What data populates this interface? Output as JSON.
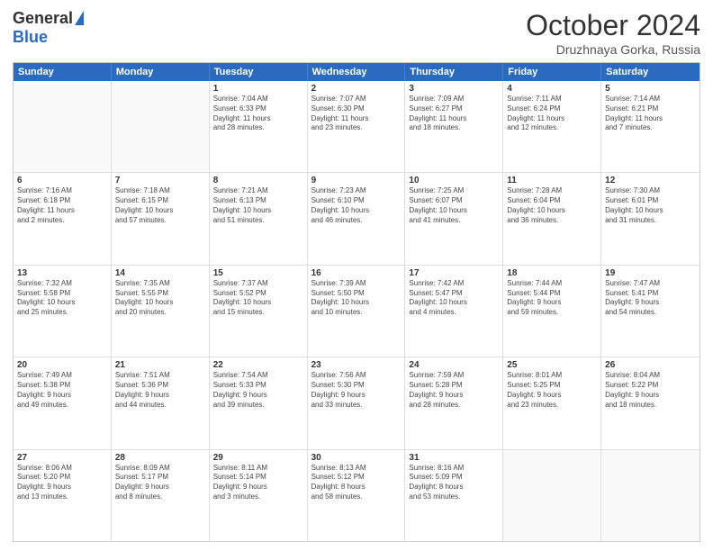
{
  "logo": {
    "general": "General",
    "blue": "Blue"
  },
  "header": {
    "title": "October 2024",
    "subtitle": "Druzhnaya Gorka, Russia"
  },
  "weekdays": [
    "Sunday",
    "Monday",
    "Tuesday",
    "Wednesday",
    "Thursday",
    "Friday",
    "Saturday"
  ],
  "rows": [
    [
      {
        "day": "",
        "lines": []
      },
      {
        "day": "",
        "lines": []
      },
      {
        "day": "1",
        "lines": [
          "Sunrise: 7:04 AM",
          "Sunset: 6:33 PM",
          "Daylight: 11 hours",
          "and 28 minutes."
        ]
      },
      {
        "day": "2",
        "lines": [
          "Sunrise: 7:07 AM",
          "Sunset: 6:30 PM",
          "Daylight: 11 hours",
          "and 23 minutes."
        ]
      },
      {
        "day": "3",
        "lines": [
          "Sunrise: 7:09 AM",
          "Sunset: 6:27 PM",
          "Daylight: 11 hours",
          "and 18 minutes."
        ]
      },
      {
        "day": "4",
        "lines": [
          "Sunrise: 7:11 AM",
          "Sunset: 6:24 PM",
          "Daylight: 11 hours",
          "and 12 minutes."
        ]
      },
      {
        "day": "5",
        "lines": [
          "Sunrise: 7:14 AM",
          "Sunset: 6:21 PM",
          "Daylight: 11 hours",
          "and 7 minutes."
        ]
      }
    ],
    [
      {
        "day": "6",
        "lines": [
          "Sunrise: 7:16 AM",
          "Sunset: 6:18 PM",
          "Daylight: 11 hours",
          "and 2 minutes."
        ]
      },
      {
        "day": "7",
        "lines": [
          "Sunrise: 7:18 AM",
          "Sunset: 6:15 PM",
          "Daylight: 10 hours",
          "and 57 minutes."
        ]
      },
      {
        "day": "8",
        "lines": [
          "Sunrise: 7:21 AM",
          "Sunset: 6:13 PM",
          "Daylight: 10 hours",
          "and 51 minutes."
        ]
      },
      {
        "day": "9",
        "lines": [
          "Sunrise: 7:23 AM",
          "Sunset: 6:10 PM",
          "Daylight: 10 hours",
          "and 46 minutes."
        ]
      },
      {
        "day": "10",
        "lines": [
          "Sunrise: 7:25 AM",
          "Sunset: 6:07 PM",
          "Daylight: 10 hours",
          "and 41 minutes."
        ]
      },
      {
        "day": "11",
        "lines": [
          "Sunrise: 7:28 AM",
          "Sunset: 6:04 PM",
          "Daylight: 10 hours",
          "and 36 minutes."
        ]
      },
      {
        "day": "12",
        "lines": [
          "Sunrise: 7:30 AM",
          "Sunset: 6:01 PM",
          "Daylight: 10 hours",
          "and 31 minutes."
        ]
      }
    ],
    [
      {
        "day": "13",
        "lines": [
          "Sunrise: 7:32 AM",
          "Sunset: 5:58 PM",
          "Daylight: 10 hours",
          "and 25 minutes."
        ]
      },
      {
        "day": "14",
        "lines": [
          "Sunrise: 7:35 AM",
          "Sunset: 5:55 PM",
          "Daylight: 10 hours",
          "and 20 minutes."
        ]
      },
      {
        "day": "15",
        "lines": [
          "Sunrise: 7:37 AM",
          "Sunset: 5:52 PM",
          "Daylight: 10 hours",
          "and 15 minutes."
        ]
      },
      {
        "day": "16",
        "lines": [
          "Sunrise: 7:39 AM",
          "Sunset: 5:50 PM",
          "Daylight: 10 hours",
          "and 10 minutes."
        ]
      },
      {
        "day": "17",
        "lines": [
          "Sunrise: 7:42 AM",
          "Sunset: 5:47 PM",
          "Daylight: 10 hours",
          "and 4 minutes."
        ]
      },
      {
        "day": "18",
        "lines": [
          "Sunrise: 7:44 AM",
          "Sunset: 5:44 PM",
          "Daylight: 9 hours",
          "and 59 minutes."
        ]
      },
      {
        "day": "19",
        "lines": [
          "Sunrise: 7:47 AM",
          "Sunset: 5:41 PM",
          "Daylight: 9 hours",
          "and 54 minutes."
        ]
      }
    ],
    [
      {
        "day": "20",
        "lines": [
          "Sunrise: 7:49 AM",
          "Sunset: 5:38 PM",
          "Daylight: 9 hours",
          "and 49 minutes."
        ]
      },
      {
        "day": "21",
        "lines": [
          "Sunrise: 7:51 AM",
          "Sunset: 5:36 PM",
          "Daylight: 9 hours",
          "and 44 minutes."
        ]
      },
      {
        "day": "22",
        "lines": [
          "Sunrise: 7:54 AM",
          "Sunset: 5:33 PM",
          "Daylight: 9 hours",
          "and 39 minutes."
        ]
      },
      {
        "day": "23",
        "lines": [
          "Sunrise: 7:56 AM",
          "Sunset: 5:30 PM",
          "Daylight: 9 hours",
          "and 33 minutes."
        ]
      },
      {
        "day": "24",
        "lines": [
          "Sunrise: 7:59 AM",
          "Sunset: 5:28 PM",
          "Daylight: 9 hours",
          "and 28 minutes."
        ]
      },
      {
        "day": "25",
        "lines": [
          "Sunrise: 8:01 AM",
          "Sunset: 5:25 PM",
          "Daylight: 9 hours",
          "and 23 minutes."
        ]
      },
      {
        "day": "26",
        "lines": [
          "Sunrise: 8:04 AM",
          "Sunset: 5:22 PM",
          "Daylight: 9 hours",
          "and 18 minutes."
        ]
      }
    ],
    [
      {
        "day": "27",
        "lines": [
          "Sunrise: 8:06 AM",
          "Sunset: 5:20 PM",
          "Daylight: 9 hours",
          "and 13 minutes."
        ]
      },
      {
        "day": "28",
        "lines": [
          "Sunrise: 8:09 AM",
          "Sunset: 5:17 PM",
          "Daylight: 9 hours",
          "and 8 minutes."
        ]
      },
      {
        "day": "29",
        "lines": [
          "Sunrise: 8:11 AM",
          "Sunset: 5:14 PM",
          "Daylight: 9 hours",
          "and 3 minutes."
        ]
      },
      {
        "day": "30",
        "lines": [
          "Sunrise: 8:13 AM",
          "Sunset: 5:12 PM",
          "Daylight: 8 hours",
          "and 58 minutes."
        ]
      },
      {
        "day": "31",
        "lines": [
          "Sunrise: 8:16 AM",
          "Sunset: 5:09 PM",
          "Daylight: 8 hours",
          "and 53 minutes."
        ]
      },
      {
        "day": "",
        "lines": []
      },
      {
        "day": "",
        "lines": []
      }
    ]
  ]
}
